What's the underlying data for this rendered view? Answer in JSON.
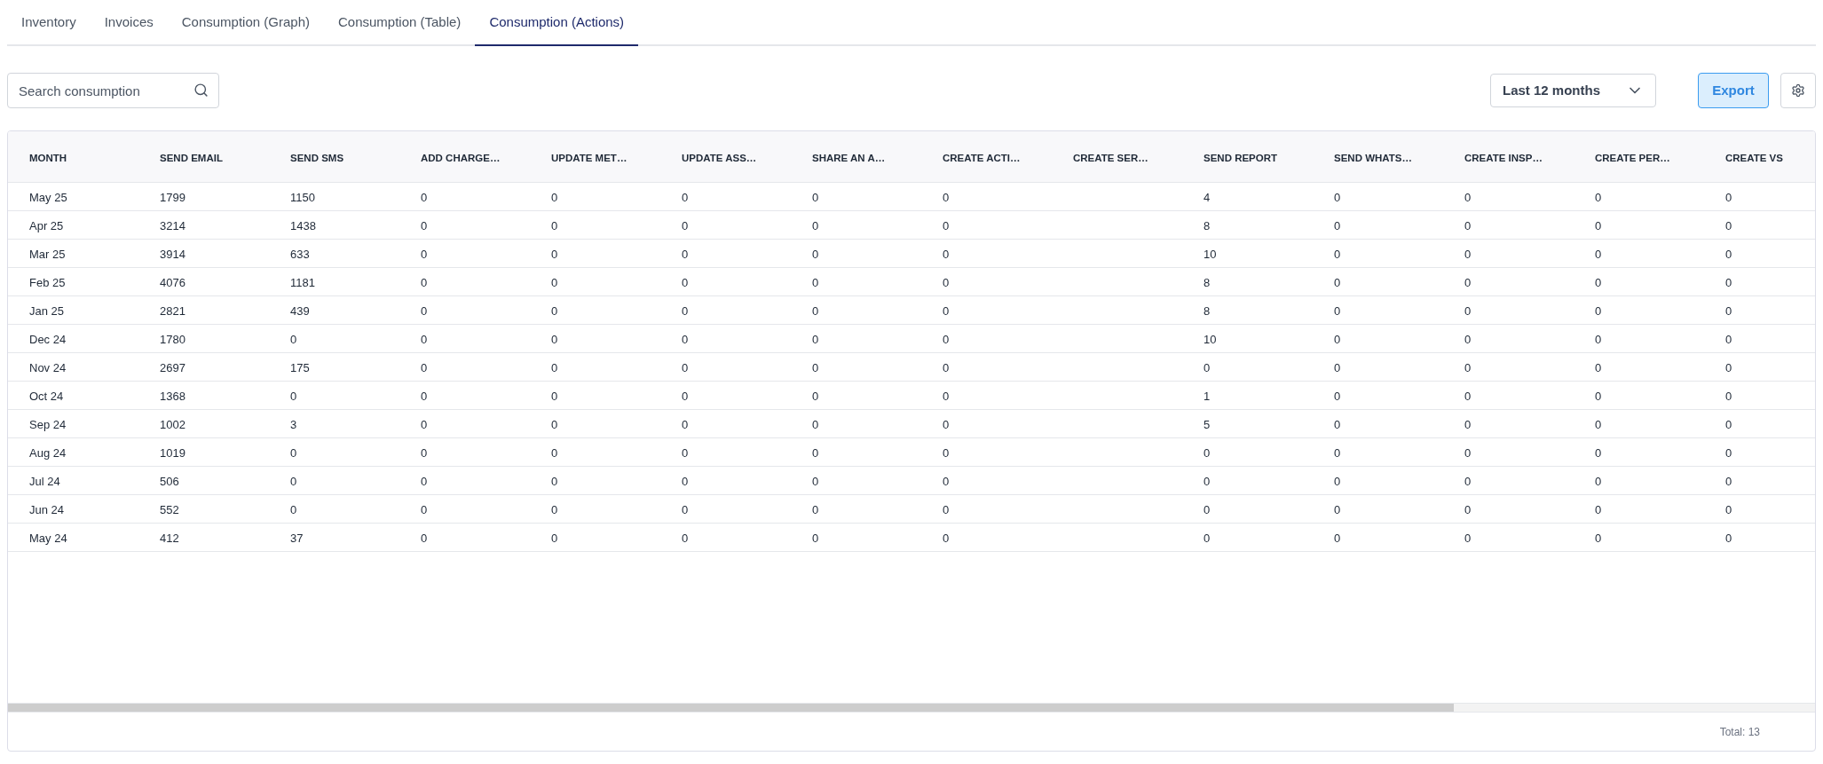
{
  "tabs": [
    {
      "label": "Inventory",
      "selected": false
    },
    {
      "label": "Invoices",
      "selected": false
    },
    {
      "label": "Consumption (Graph)",
      "selected": false
    },
    {
      "label": "Consumption (Table)",
      "selected": false
    },
    {
      "label": "Consumption (Actions)",
      "selected": true
    }
  ],
  "search": {
    "placeholder": "Search consumption"
  },
  "period_select": {
    "value": "Last 12 months"
  },
  "export_button": {
    "label": "Export"
  },
  "table": {
    "columns": [
      "MONTH",
      "SEND EMAIL",
      "SEND SMS",
      "ADD CHARGE…",
      "UPDATE MET…",
      "UPDATE ASS…",
      "SHARE AN A…",
      "CREATE ACTI…",
      "CREATE SER…",
      "SEND REPORT",
      "SEND WHATS…",
      "CREATE INSP…",
      "CREATE PER…",
      "CREATE VS"
    ],
    "rows": [
      [
        "May 25",
        "1799",
        "1150",
        "0",
        "0",
        "0",
        "0",
        "0",
        null,
        "4",
        "0",
        "0",
        "0",
        "0"
      ],
      [
        "Apr 25",
        "3214",
        "1438",
        "0",
        "0",
        "0",
        "0",
        "0",
        null,
        "8",
        "0",
        "0",
        "0",
        "0"
      ],
      [
        "Mar 25",
        "3914",
        "633",
        "0",
        "0",
        "0",
        "0",
        "0",
        null,
        "10",
        "0",
        "0",
        "0",
        "0"
      ],
      [
        "Feb 25",
        "4076",
        "1181",
        "0",
        "0",
        "0",
        "0",
        "0",
        null,
        "8",
        "0",
        "0",
        "0",
        "0"
      ],
      [
        "Jan 25",
        "2821",
        "439",
        "0",
        "0",
        "0",
        "0",
        "0",
        null,
        "8",
        "0",
        "0",
        "0",
        "0"
      ],
      [
        "Dec 24",
        "1780",
        "0",
        "0",
        "0",
        "0",
        "0",
        "0",
        null,
        "10",
        "0",
        "0",
        "0",
        "0"
      ],
      [
        "Nov 24",
        "2697",
        "175",
        "0",
        "0",
        "0",
        "0",
        "0",
        null,
        "0",
        "0",
        "0",
        "0",
        "0"
      ],
      [
        "Oct 24",
        "1368",
        "0",
        "0",
        "0",
        "0",
        "0",
        "0",
        null,
        "1",
        "0",
        "0",
        "0",
        "0"
      ],
      [
        "Sep 24",
        "1002",
        "3",
        "0",
        "0",
        "0",
        "0",
        "0",
        null,
        "5",
        "0",
        "0",
        "0",
        "0"
      ],
      [
        "Aug 24",
        "1019",
        "0",
        "0",
        "0",
        "0",
        "0",
        "0",
        null,
        "0",
        "0",
        "0",
        "0",
        "0"
      ],
      [
        "Jul 24",
        "506",
        "0",
        "0",
        "0",
        "0",
        "0",
        "0",
        null,
        "0",
        "0",
        "0",
        "0",
        "0"
      ],
      [
        "Jun 24",
        "552",
        "0",
        "0",
        "0",
        "0",
        "0",
        "0",
        null,
        "0",
        "0",
        "0",
        "0",
        "0"
      ],
      [
        "May 24",
        "412",
        "37",
        "0",
        "0",
        "0",
        "0",
        "0",
        null,
        "0",
        "0",
        "0",
        "0",
        "0"
      ]
    ],
    "total": "Total: 13"
  }
}
